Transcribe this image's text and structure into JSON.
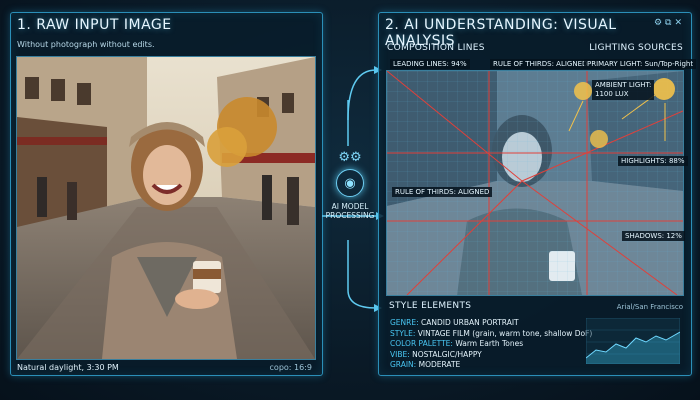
{
  "left_panel": {
    "title": "1. RAW INPUT IMAGE",
    "subtitle": "Without photograph without edits.",
    "footer_left": "Natural daylight, 3:30 PM",
    "footer_right": "copo: 16:9"
  },
  "center": {
    "label_line1": "AI MODEL",
    "label_line2": "PROCESSING",
    "brain_icon": "brain-icon",
    "gear_icon": "gears-icon"
  },
  "right_panel": {
    "title": "2. AI UNDERSTANDING: VISUAL ANALYSIS",
    "composition_head": "COMPOSITION LINES",
    "lighting_head": "LIGHTING SOURCES",
    "tags": {
      "leading_lines": "LEADING LINES: 94%",
      "rule_top": "RULE OF THIRDS: ALIGNED",
      "primary_light": "PRIMARY LIGHT: Sun/Top-Right",
      "ambient": "AMBIENT LIGHT:",
      "ambient_value": "1100 LUX",
      "highlights": "HIGHLIGHTS: 88%",
      "rule_left": "RULE OF THIRDS: ALIGNED",
      "shadows": "SHADOWS: 12%"
    },
    "style_head": "STYLE ELEMENTS",
    "font_note": "Arial/San Francisco",
    "style_items": [
      {
        "key": "GENRE:",
        "value": "CANDID URBAN PORTRAIT"
      },
      {
        "key": "STYLE:",
        "value": "VINTAGE FILM (grain, warm tone, shallow DoF)"
      },
      {
        "key": "COLOR PALETTE:",
        "value": "Warm Earth Tones"
      },
      {
        "key": "VIBE:",
        "value": "NOSTALGIC/HAPPY"
      },
      {
        "key": "GRAIN:",
        "value": "MODERATE"
      }
    ]
  },
  "colors": {
    "accent": "#2b8fb8",
    "glow": "#6fd0f5",
    "guide_red": "#e0403a",
    "light_orb": "#f3c24a"
  }
}
